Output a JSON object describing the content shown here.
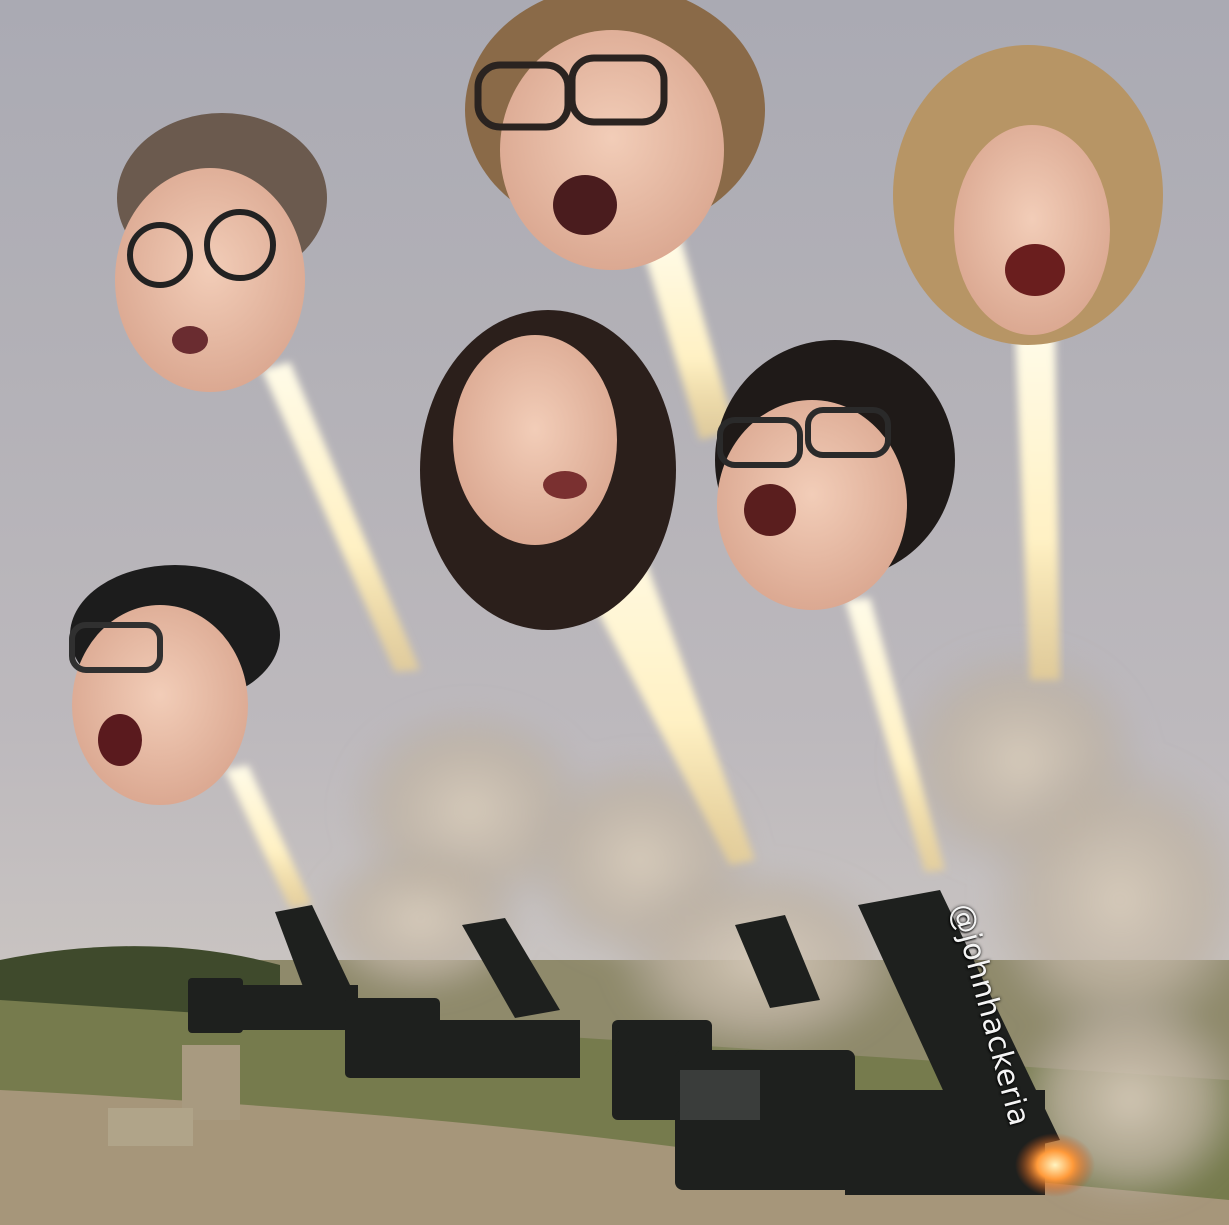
{
  "image": {
    "subject": "meme-photo",
    "watermark_text": "@johnhackeria",
    "colors": {
      "sky": "#b1afb6",
      "smoke": "#cfc3b6",
      "exhaust": "#fff6d8",
      "trucks": "#1d1f1d",
      "grass": "#6f7648",
      "dirt": "#a39275",
      "skin": "#e8bfa8"
    }
  }
}
